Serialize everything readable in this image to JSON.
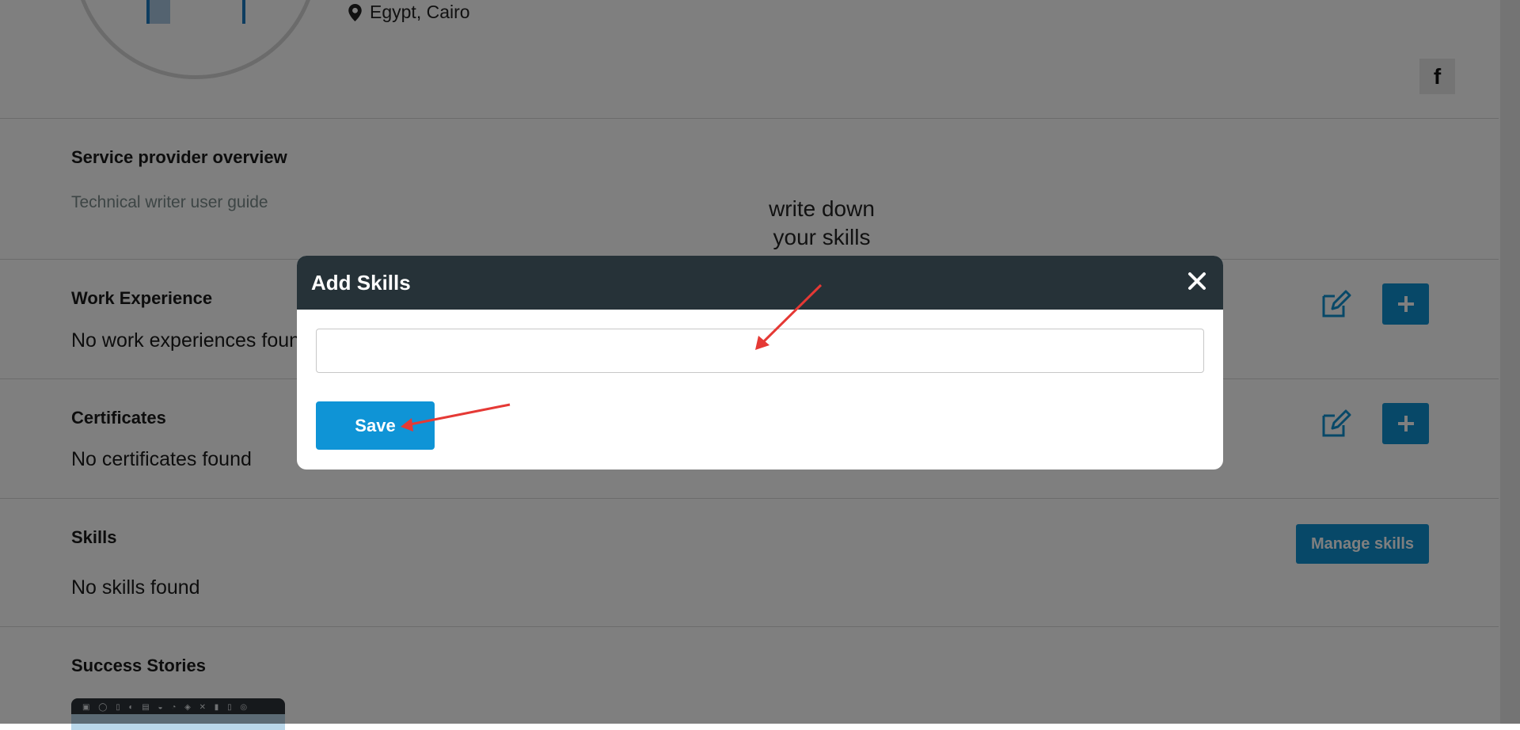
{
  "profile": {
    "location": "Egypt, Cairo",
    "social": {
      "facebook_icon_glyph": "f"
    }
  },
  "sections": {
    "overview": {
      "title": "Service provider overview",
      "text": "Technical writer user guide"
    },
    "work_experience": {
      "title": "Work Experience",
      "empty_text": "No work experiences found"
    },
    "certificates": {
      "title": "Certificates",
      "empty_text": "No certificates found"
    },
    "skills": {
      "title": "Skills",
      "empty_text": "No skills found",
      "manage_label": "Manage skills"
    },
    "success_stories": {
      "title": "Success Stories"
    }
  },
  "modal": {
    "title": "Add Skills",
    "input": {
      "value": "",
      "placeholder": ""
    },
    "save_label": "Save"
  },
  "annotation": {
    "line1": "write down",
    "line2": "your skills"
  },
  "colors": {
    "primary": "#0f94d6",
    "modal_header": "#263238",
    "annotation_arrow": "#e53935",
    "overlay": "rgba(0,0,0,0.5)"
  },
  "icons": [
    "location-pin-icon",
    "facebook-icon",
    "edit-icon",
    "plus-icon",
    "close-icon",
    "arrow-icon"
  ]
}
